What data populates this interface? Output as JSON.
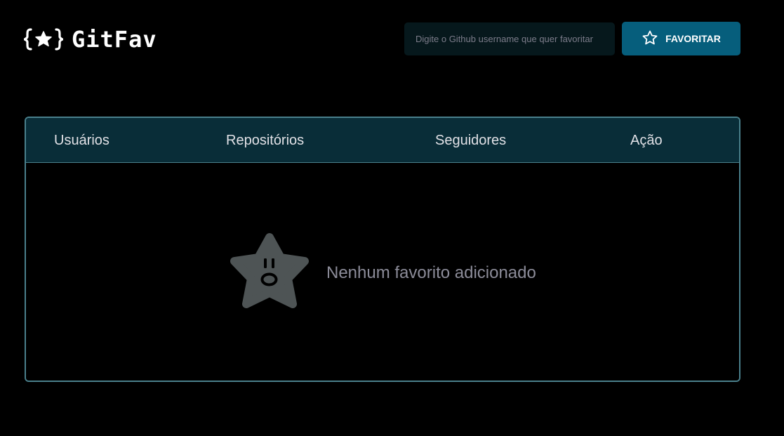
{
  "header": {
    "logo_text": "GitFav",
    "logo_icon": "star-in-braces-icon",
    "search": {
      "placeholder": "Digite o Github username que quer favoritar",
      "value": ""
    },
    "favorite_button": {
      "label": "FAVORITAR",
      "icon": "star-outline-icon"
    }
  },
  "table": {
    "columns": [
      "Usuários",
      "Repositórios",
      "Seguidores",
      "Ação"
    ],
    "rows": [],
    "empty_state": {
      "message": "Nenhum favorito adicionado",
      "icon": "surprised-star-icon"
    }
  },
  "colors": {
    "background": "#000000",
    "accent": "#065E7C",
    "table_header": "#092D38",
    "table_border": "#4A808C",
    "input_bg": "#06181C",
    "muted_text": "#8C8C99",
    "empty_star": "#4E5455"
  }
}
